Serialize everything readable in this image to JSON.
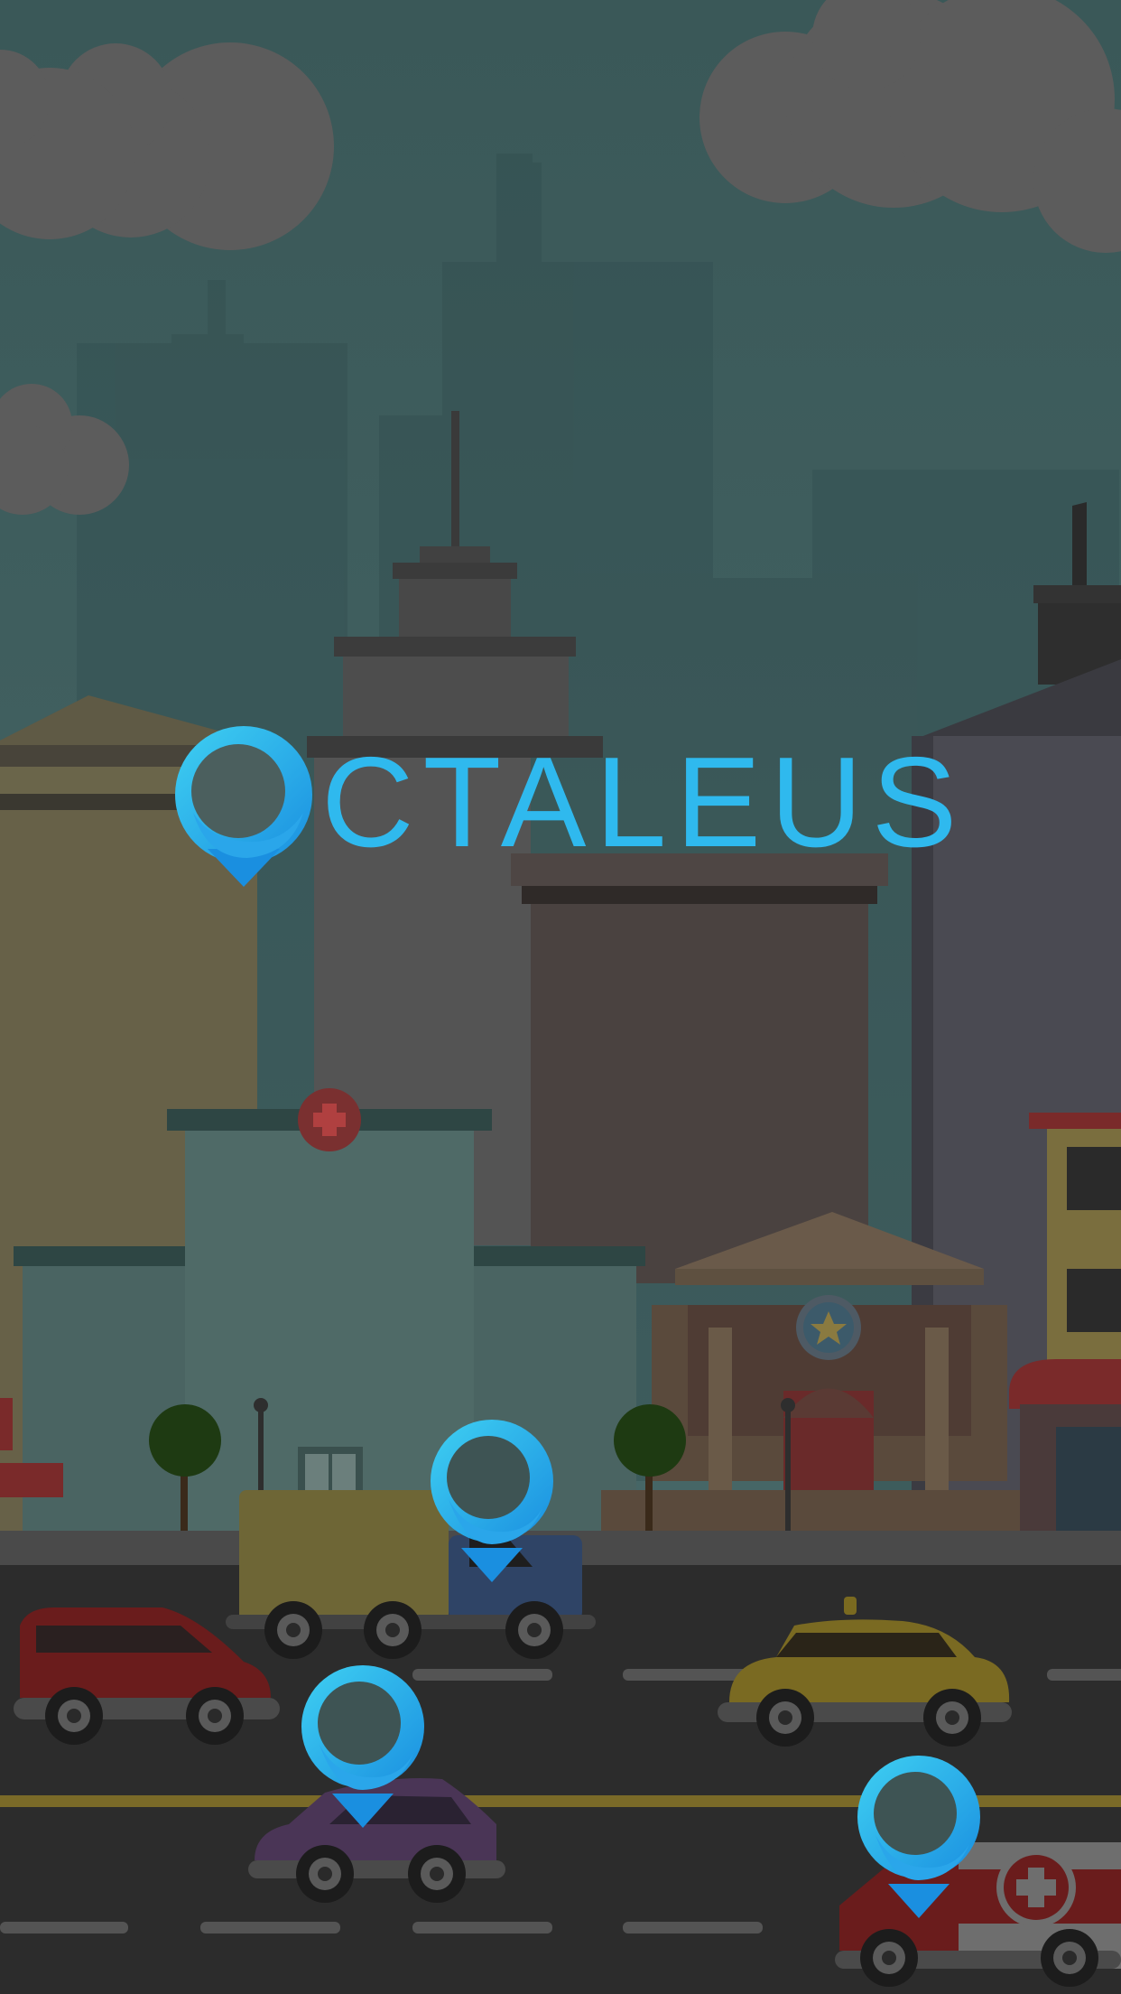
{
  "app": {
    "brand_name": "CTALEUS",
    "logo_icon": "location-pin-icon"
  },
  "colors": {
    "sky": "#3f5c5c",
    "accent": "#2ab4ec",
    "accent_light": "#3fd0f2",
    "road": "#2f2f2f",
    "road_stripe": "#545454",
    "road_center_line": "#8a7a2c",
    "cloud": "#5c5c5c",
    "overlay_dim": "#000000"
  },
  "scene": {
    "map_pins": [
      {
        "name": "map-pin-truck",
        "icon": "map-pin-icon"
      },
      {
        "name": "map-pin-purple-car",
        "icon": "map-pin-icon"
      },
      {
        "name": "map-pin-ambulance",
        "icon": "map-pin-icon"
      }
    ],
    "vehicles": [
      "red-minivan",
      "delivery-truck",
      "taxi",
      "purple-car",
      "ambulance"
    ],
    "buildings": [
      "tan-apartment",
      "grey-tower",
      "brown-office",
      "hospital",
      "courthouse",
      "dark-skyscraper",
      "corner-shop"
    ]
  }
}
